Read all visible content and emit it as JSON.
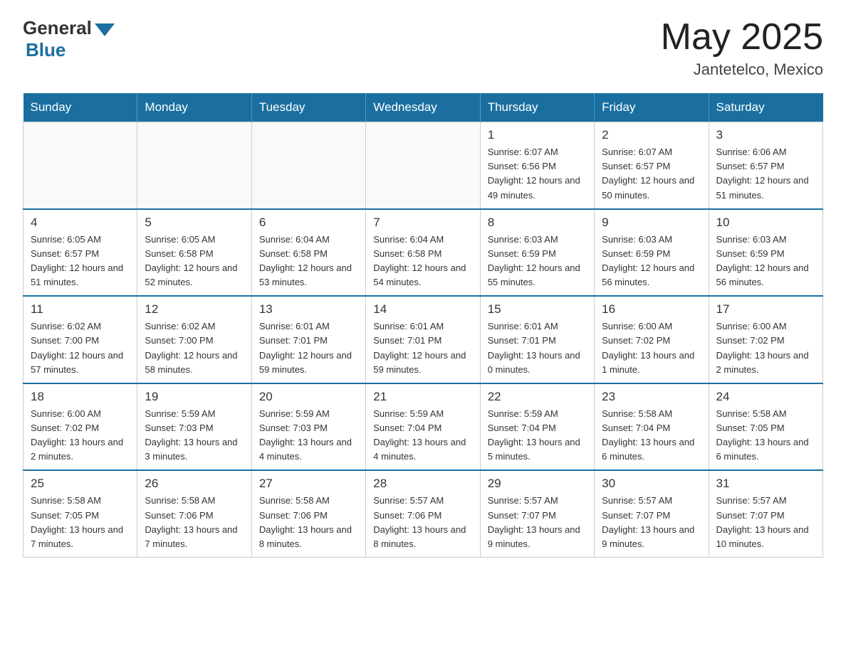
{
  "header": {
    "logo_general": "General",
    "logo_blue": "Blue",
    "month_year": "May 2025",
    "location": "Jantetelco, Mexico"
  },
  "days_of_week": [
    "Sunday",
    "Monday",
    "Tuesday",
    "Wednesday",
    "Thursday",
    "Friday",
    "Saturday"
  ],
  "weeks": [
    [
      {
        "day": "",
        "info": ""
      },
      {
        "day": "",
        "info": ""
      },
      {
        "day": "",
        "info": ""
      },
      {
        "day": "",
        "info": ""
      },
      {
        "day": "1",
        "info": "Sunrise: 6:07 AM\nSunset: 6:56 PM\nDaylight: 12 hours and 49 minutes."
      },
      {
        "day": "2",
        "info": "Sunrise: 6:07 AM\nSunset: 6:57 PM\nDaylight: 12 hours and 50 minutes."
      },
      {
        "day": "3",
        "info": "Sunrise: 6:06 AM\nSunset: 6:57 PM\nDaylight: 12 hours and 51 minutes."
      }
    ],
    [
      {
        "day": "4",
        "info": "Sunrise: 6:05 AM\nSunset: 6:57 PM\nDaylight: 12 hours and 51 minutes."
      },
      {
        "day": "5",
        "info": "Sunrise: 6:05 AM\nSunset: 6:58 PM\nDaylight: 12 hours and 52 minutes."
      },
      {
        "day": "6",
        "info": "Sunrise: 6:04 AM\nSunset: 6:58 PM\nDaylight: 12 hours and 53 minutes."
      },
      {
        "day": "7",
        "info": "Sunrise: 6:04 AM\nSunset: 6:58 PM\nDaylight: 12 hours and 54 minutes."
      },
      {
        "day": "8",
        "info": "Sunrise: 6:03 AM\nSunset: 6:59 PM\nDaylight: 12 hours and 55 minutes."
      },
      {
        "day": "9",
        "info": "Sunrise: 6:03 AM\nSunset: 6:59 PM\nDaylight: 12 hours and 56 minutes."
      },
      {
        "day": "10",
        "info": "Sunrise: 6:03 AM\nSunset: 6:59 PM\nDaylight: 12 hours and 56 minutes."
      }
    ],
    [
      {
        "day": "11",
        "info": "Sunrise: 6:02 AM\nSunset: 7:00 PM\nDaylight: 12 hours and 57 minutes."
      },
      {
        "day": "12",
        "info": "Sunrise: 6:02 AM\nSunset: 7:00 PM\nDaylight: 12 hours and 58 minutes."
      },
      {
        "day": "13",
        "info": "Sunrise: 6:01 AM\nSunset: 7:01 PM\nDaylight: 12 hours and 59 minutes."
      },
      {
        "day": "14",
        "info": "Sunrise: 6:01 AM\nSunset: 7:01 PM\nDaylight: 12 hours and 59 minutes."
      },
      {
        "day": "15",
        "info": "Sunrise: 6:01 AM\nSunset: 7:01 PM\nDaylight: 13 hours and 0 minutes."
      },
      {
        "day": "16",
        "info": "Sunrise: 6:00 AM\nSunset: 7:02 PM\nDaylight: 13 hours and 1 minute."
      },
      {
        "day": "17",
        "info": "Sunrise: 6:00 AM\nSunset: 7:02 PM\nDaylight: 13 hours and 2 minutes."
      }
    ],
    [
      {
        "day": "18",
        "info": "Sunrise: 6:00 AM\nSunset: 7:02 PM\nDaylight: 13 hours and 2 minutes."
      },
      {
        "day": "19",
        "info": "Sunrise: 5:59 AM\nSunset: 7:03 PM\nDaylight: 13 hours and 3 minutes."
      },
      {
        "day": "20",
        "info": "Sunrise: 5:59 AM\nSunset: 7:03 PM\nDaylight: 13 hours and 4 minutes."
      },
      {
        "day": "21",
        "info": "Sunrise: 5:59 AM\nSunset: 7:04 PM\nDaylight: 13 hours and 4 minutes."
      },
      {
        "day": "22",
        "info": "Sunrise: 5:59 AM\nSunset: 7:04 PM\nDaylight: 13 hours and 5 minutes."
      },
      {
        "day": "23",
        "info": "Sunrise: 5:58 AM\nSunset: 7:04 PM\nDaylight: 13 hours and 6 minutes."
      },
      {
        "day": "24",
        "info": "Sunrise: 5:58 AM\nSunset: 7:05 PM\nDaylight: 13 hours and 6 minutes."
      }
    ],
    [
      {
        "day": "25",
        "info": "Sunrise: 5:58 AM\nSunset: 7:05 PM\nDaylight: 13 hours and 7 minutes."
      },
      {
        "day": "26",
        "info": "Sunrise: 5:58 AM\nSunset: 7:06 PM\nDaylight: 13 hours and 7 minutes."
      },
      {
        "day": "27",
        "info": "Sunrise: 5:58 AM\nSunset: 7:06 PM\nDaylight: 13 hours and 8 minutes."
      },
      {
        "day": "28",
        "info": "Sunrise: 5:57 AM\nSunset: 7:06 PM\nDaylight: 13 hours and 8 minutes."
      },
      {
        "day": "29",
        "info": "Sunrise: 5:57 AM\nSunset: 7:07 PM\nDaylight: 13 hours and 9 minutes."
      },
      {
        "day": "30",
        "info": "Sunrise: 5:57 AM\nSunset: 7:07 PM\nDaylight: 13 hours and 9 minutes."
      },
      {
        "day": "31",
        "info": "Sunrise: 5:57 AM\nSunset: 7:07 PM\nDaylight: 13 hours and 10 minutes."
      }
    ]
  ]
}
